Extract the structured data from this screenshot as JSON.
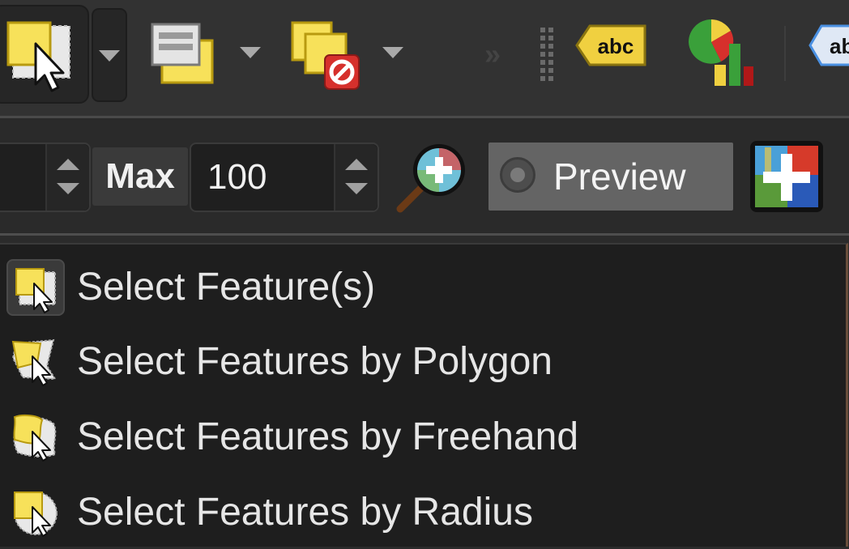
{
  "toolbar": {
    "label_tool_text": "abc",
    "label_tool2_text": "ab"
  },
  "filter": {
    "max_label": "Max",
    "max_value": "100",
    "preview_label": "Preview"
  },
  "menu": {
    "items": [
      {
        "label": "Select Feature(s)",
        "icon": "select-rectangle-icon"
      },
      {
        "label": "Select Features by Polygon",
        "icon": "select-polygon-icon"
      },
      {
        "label": "Select Features by Freehand",
        "icon": "select-freehand-icon"
      },
      {
        "label": "Select Features by Radius",
        "icon": "select-radius-icon"
      }
    ]
  },
  "colors": {
    "feature_yellow": "#f7e15a",
    "deselect_red": "#d6302c",
    "menu_bg": "#1e1e1e",
    "toolbar_bg": "#323232"
  }
}
